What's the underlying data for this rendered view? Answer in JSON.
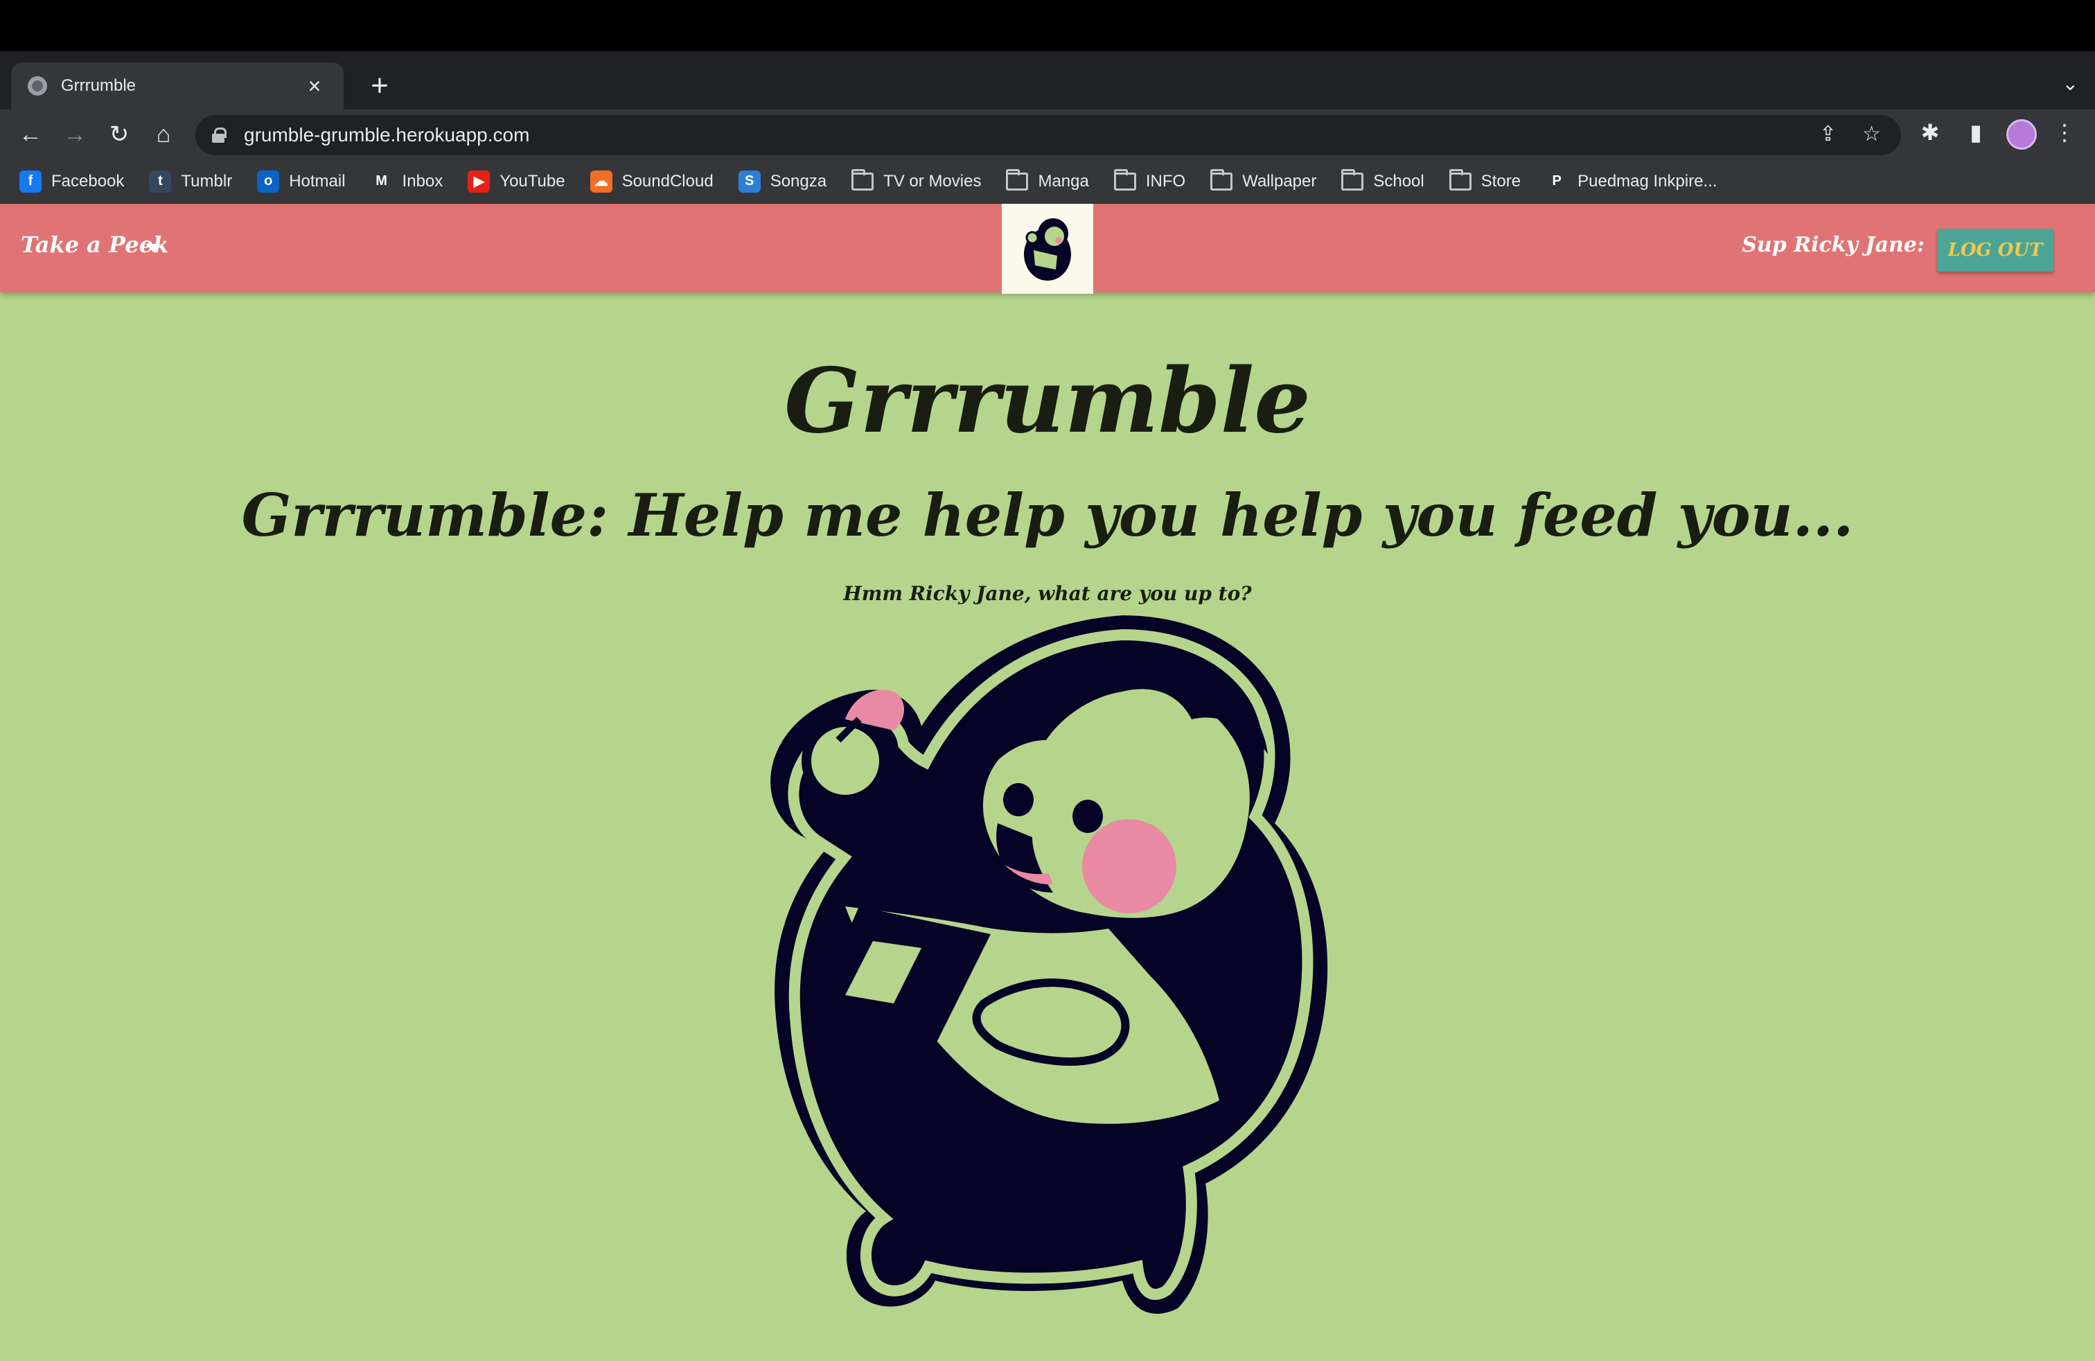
{
  "browser": {
    "tab_title": "Grrrumble",
    "tab_close": "×",
    "new_tab": "+",
    "tab_search": "⌄",
    "url": "grumble-grumble.herokuapp.com",
    "back": "←",
    "forward": "→",
    "reload": "↻",
    "home": "⌂",
    "share": "⇪",
    "star": "☆",
    "extensions": "✱",
    "sidepanel": "▮",
    "menu": "⋮"
  },
  "bookmarks": [
    {
      "label": "Facebook",
      "icon": "f",
      "color": "#1877f2"
    },
    {
      "label": "Tumblr",
      "icon": "t",
      "color": "#36465d"
    },
    {
      "label": "Hotmail",
      "icon": "o",
      "color": "#0a64c8"
    },
    {
      "label": "Inbox",
      "icon": "M",
      "color": "#35363a"
    },
    {
      "label": "YouTube",
      "icon": "▶",
      "color": "#e62117"
    },
    {
      "label": "SoundCloud",
      "icon": "☁",
      "color": "#f26f23"
    },
    {
      "label": "Songza",
      "icon": "S",
      "color": "#2a7fd4"
    },
    {
      "label": "TV or Movies",
      "folder": true
    },
    {
      "label": "Manga",
      "folder": true
    },
    {
      "label": "INFO",
      "folder": true
    },
    {
      "label": "Wallpaper",
      "folder": true
    },
    {
      "label": "School",
      "folder": true
    },
    {
      "label": "Store",
      "folder": true
    },
    {
      "label": "Puedmag Inkpire...",
      "icon": "P",
      "color": "#35363a"
    }
  ],
  "navbar": {
    "menu_label": "Take a Peek",
    "greeting": "Sup Ricky Jane:",
    "logout_label": "LOG OUT"
  },
  "main": {
    "title": "Grrrumble",
    "headline": "Grrrumble: Help me help you help you feed you...",
    "subtitle": "Hmm Ricky Jane, what are you up to?"
  },
  "colors": {
    "navbar": "#e07474",
    "page_bg": "#b5d58c",
    "logout_bg": "#4ba596",
    "logout_text": "#f5c84a",
    "mascot_ink": "#050326",
    "mascot_cheek": "#e88aa4"
  }
}
